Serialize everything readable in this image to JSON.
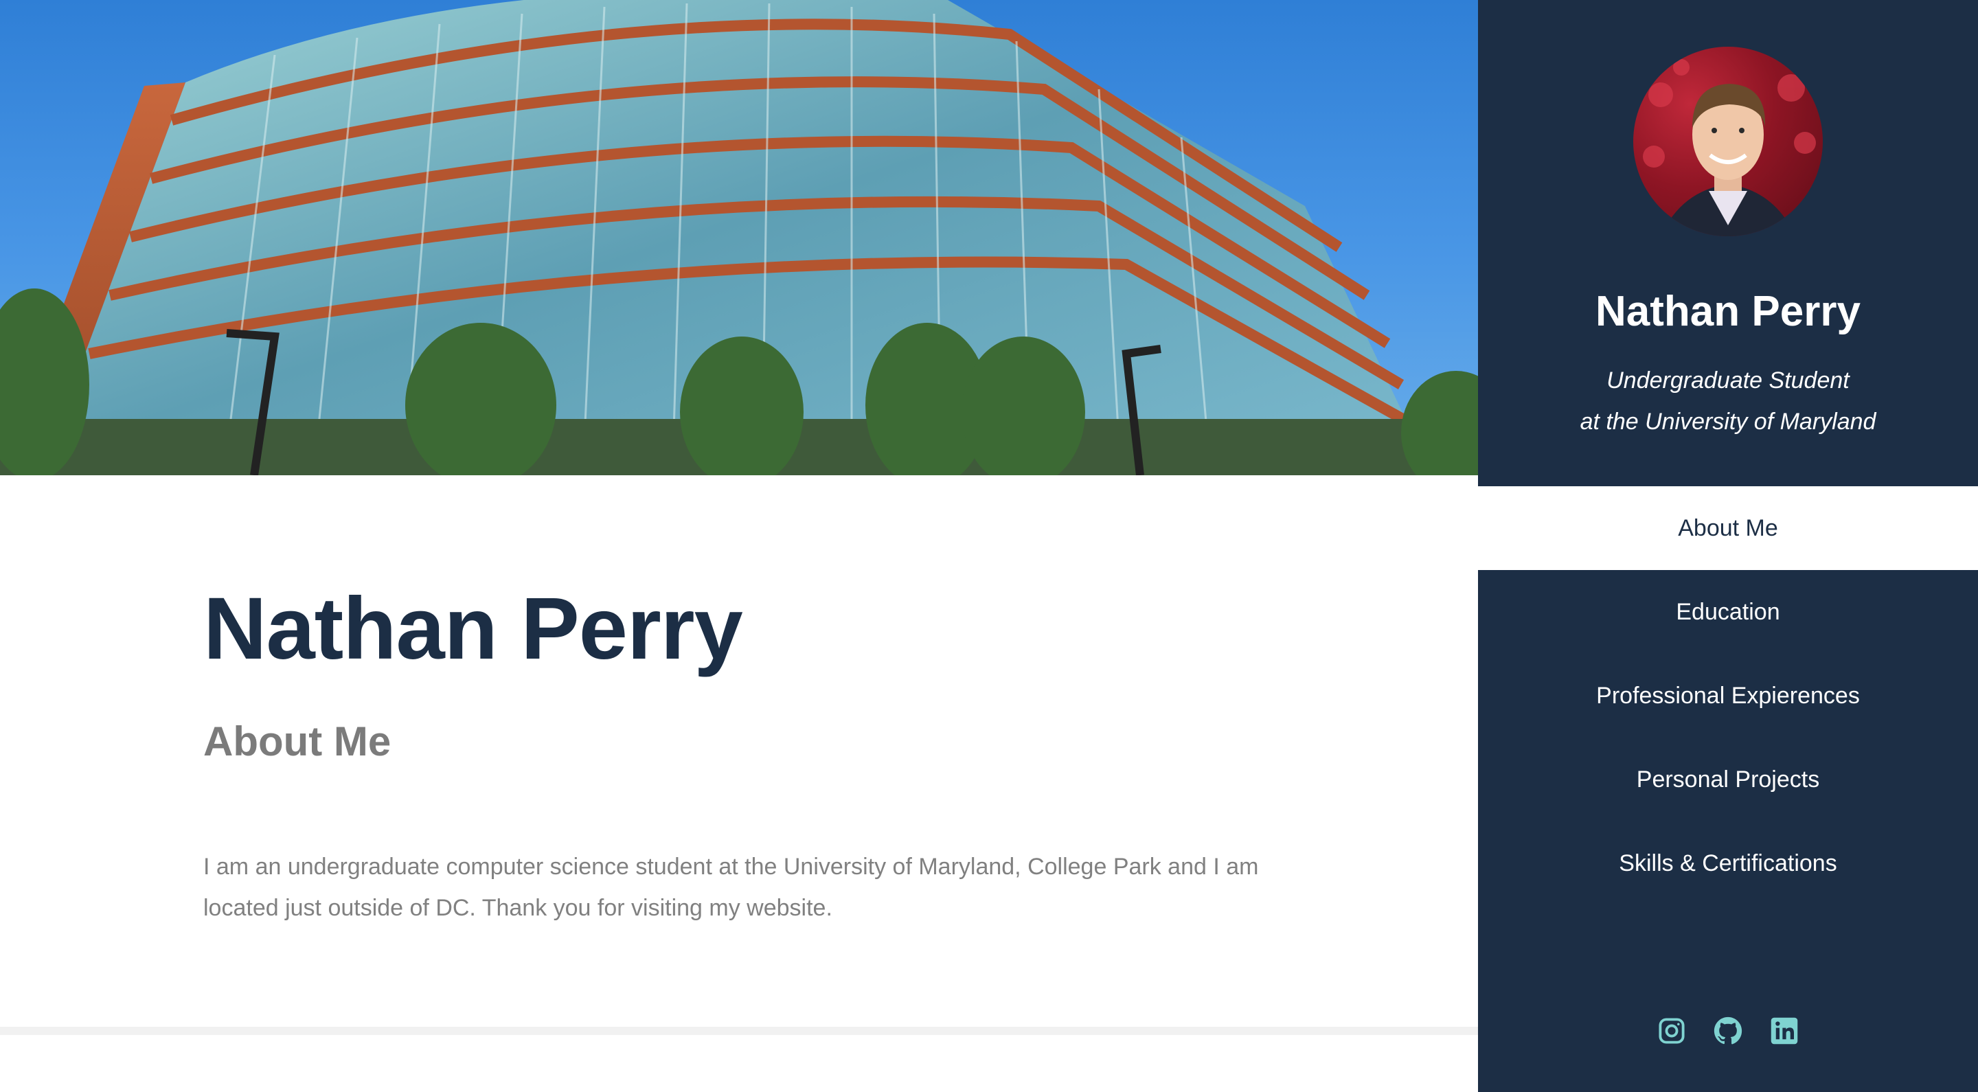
{
  "header": {
    "name": "Nathan Perry",
    "section": "About Me",
    "about_text": "I am an undergraduate computer science student at the University of Maryland, College Park and I am located just outside of DC. Thank you for visiting my website."
  },
  "sidebar": {
    "name": "Nathan Perry",
    "subtitle_line1": "Undergraduate Student",
    "subtitle_line2": "at the University of Maryland",
    "nav": [
      {
        "label": "About Me",
        "active": true
      },
      {
        "label": "Education",
        "active": false
      },
      {
        "label": "Professional Expierences",
        "active": false
      },
      {
        "label": "Personal Projects",
        "active": false
      },
      {
        "label": "Skills & Certifications",
        "active": false
      }
    ],
    "social": [
      {
        "icon": "instagram-icon"
      },
      {
        "icon": "github-icon"
      },
      {
        "icon": "linkedin-icon"
      }
    ]
  },
  "colors": {
    "sidebar_bg": "#1c2e45",
    "title": "#1c2e45",
    "muted_text": "#808080",
    "social_icon": "#7fd3d1"
  }
}
